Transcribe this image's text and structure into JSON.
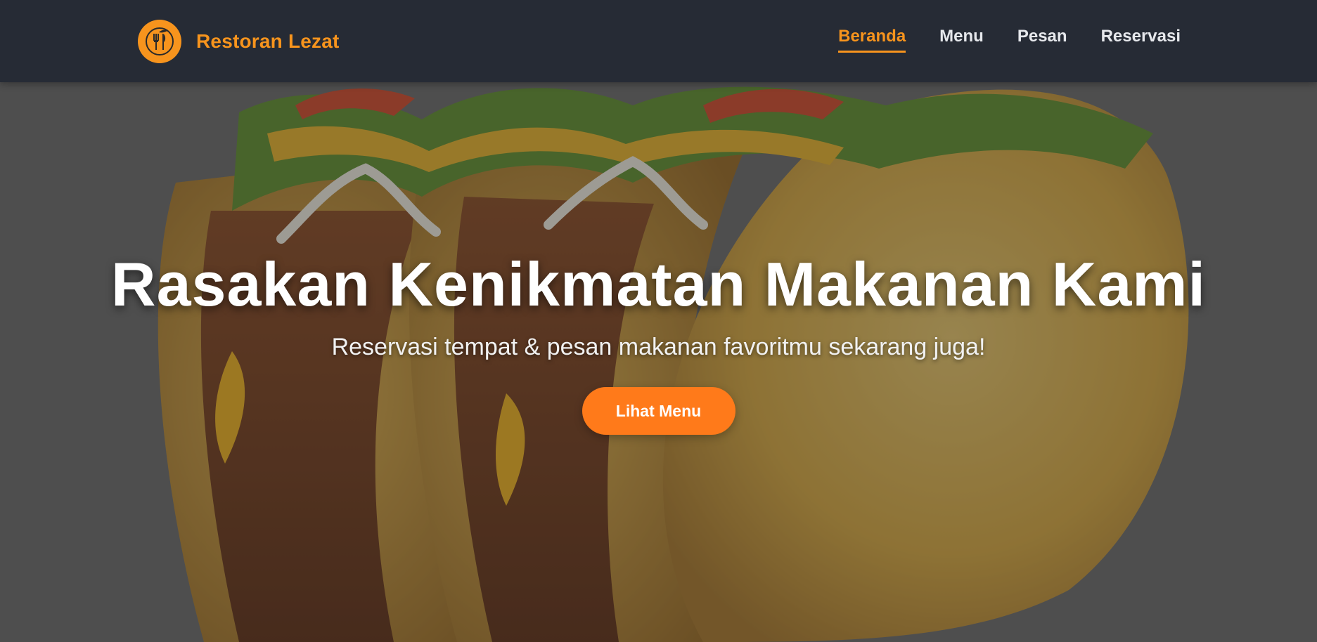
{
  "brand": {
    "name": "Restoran Lezat",
    "logo_icon": "restaurant-utensils-icon"
  },
  "nav": {
    "items": [
      {
        "label": "Beranda",
        "active": true
      },
      {
        "label": "Menu",
        "active": false
      },
      {
        "label": "Pesan",
        "active": false
      },
      {
        "label": "Reservasi",
        "active": false
      }
    ]
  },
  "hero": {
    "title": "Rasakan Kenikmatan Makanan Kami",
    "subtitle": "Reservasi tempat & pesan makanan favoritmu sekarang juga!",
    "cta_label": "Lihat Menu",
    "background_image": "tacos-photo"
  },
  "colors": {
    "accent": "#f7941d",
    "button": "#ff7a1a",
    "navbar": "#242934",
    "text_light": "#ffffff"
  }
}
